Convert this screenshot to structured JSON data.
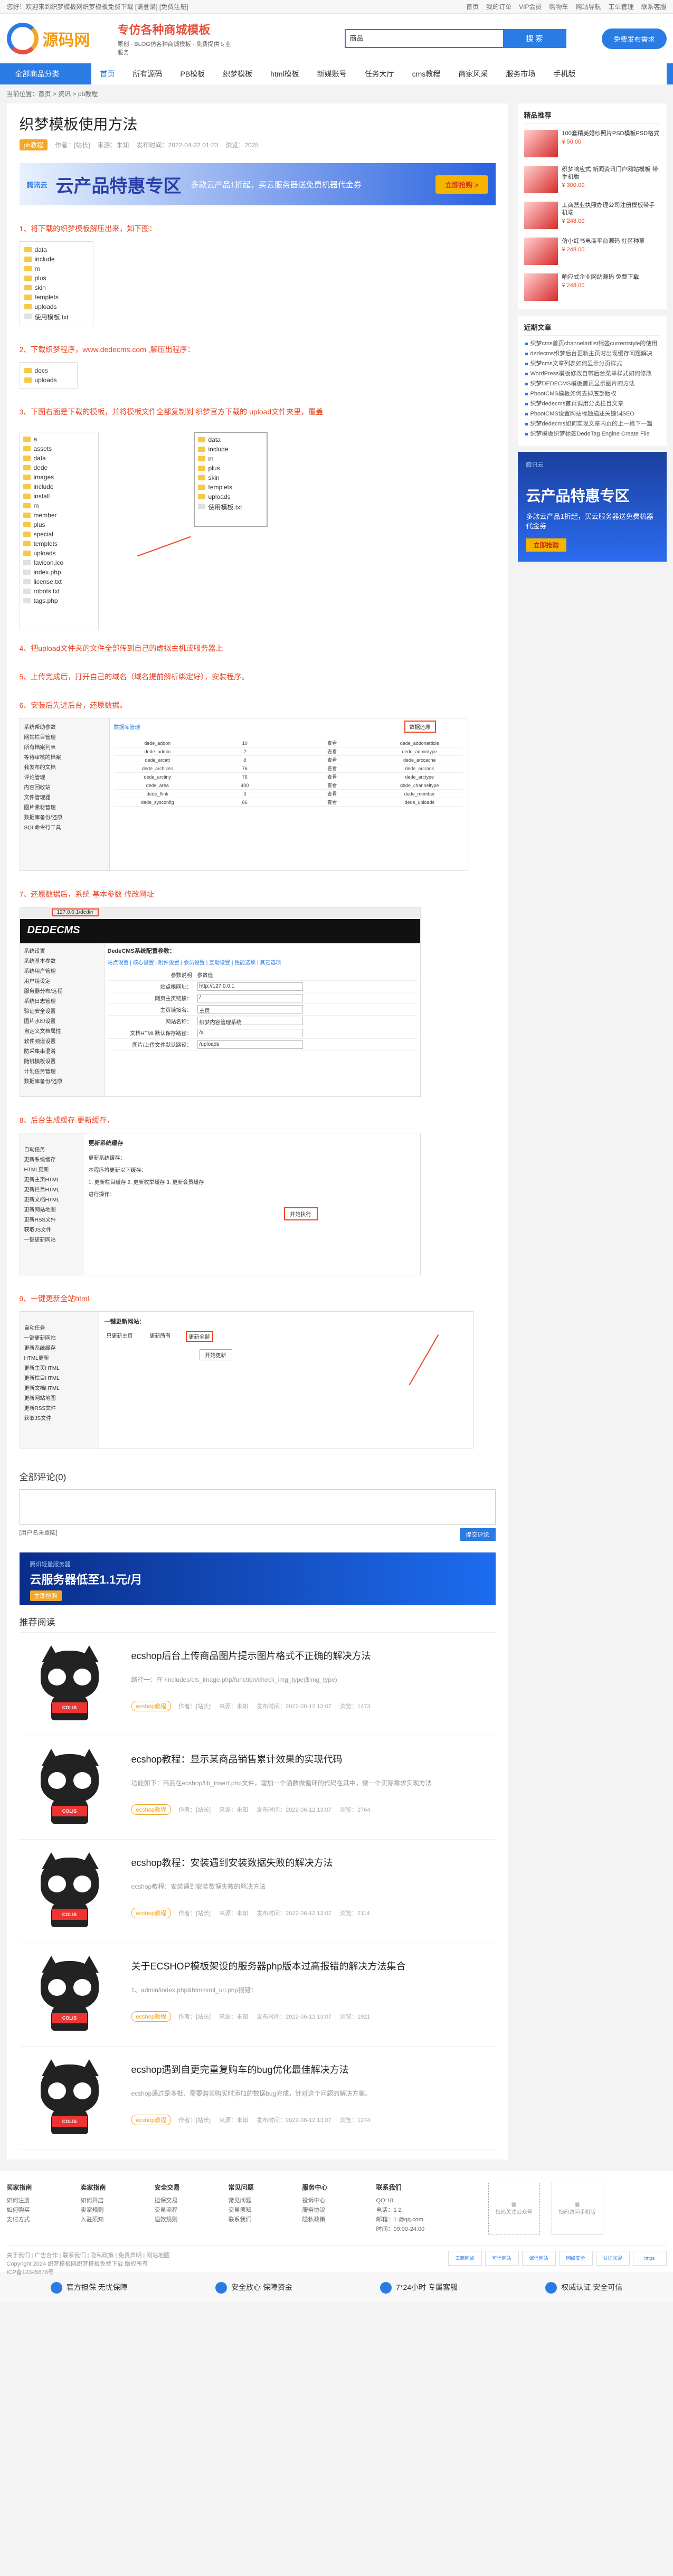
{
  "topbar": {
    "left": "您好！欢迎来到织梦模板网织梦模板免费下载 [请登录]",
    "left2": "[免费注册]",
    "links": [
      "首页",
      "我的订单",
      "VIP会员",
      "购物车",
      "网站导航",
      "工单管理",
      "联系客服"
    ]
  },
  "header": {
    "logo_text": "源码网",
    "slogan_1": "专仿各种商城模板",
    "slogan_2": "原创 · BLOG仿各种商城模板 · 免费提供专业服务",
    "search_select": "商品",
    "search_button": "搜 索",
    "search_hot": "织梦 dede 帝国 商城 主题 企业 模板",
    "cta": "免费发布需求"
  },
  "nav": {
    "category": "全部商品分类",
    "items": [
      "首页",
      "所有源码",
      "PB模板",
      "织梦模板",
      "html模板",
      "新媒账号",
      "任务大厅",
      "cms教程",
      "商家风采",
      "服务市场",
      "手机版"
    ]
  },
  "breadcrumb": "当前位置：首页 > 资讯 > pb教程",
  "article": {
    "title": "织梦模板使用方法",
    "tag": "pb教程",
    "author": "作者：[站长]",
    "source": "来源：未知",
    "time": "发布时间：2022-04-22 01:23",
    "views": "浏览：2025",
    "ad": {
      "brand": "腾讯云",
      "big": "云产品特惠专区",
      "sub": "多款云产品1折起，买云服务器送免费机器代金券",
      "cta": "立即抢购 >"
    },
    "steps": [
      "1、将下载的织梦模板解压出来，如下图：",
      "2、下载织梦程序，www.dedecms.com ,解压出程序：",
      "3、下图右面是下载的模板，并将模板文件全部复制到 织梦官方下载的 upload文件夹里，覆盖",
      "4、把upload文件夹的文件全部传到自己的虚拟主机或服务器上",
      "5、上传完成后，打开自己的域名（域名提前解析绑定好），安装程序。",
      "6、安装后先进后台，还原数据。",
      "7、还原数据后，系统-基本参数-修改网址",
      "8、后台生成缓存 更新缓存，",
      "9、一键更新全站html"
    ],
    "folders1": [
      "data",
      "include",
      "m",
      "plus",
      "skin",
      "templets",
      "uploads",
      "使用模板.txt"
    ],
    "folders2": [
      "docs",
      "uploads"
    ],
    "folders3a": [
      "a",
      "assets",
      "data",
      "dede",
      "images",
      "include",
      "install",
      "m",
      "member",
      "plus",
      "special",
      "templets",
      "uploads",
      "favicon.ico",
      "index.php",
      "license.txt",
      "robots.txt",
      "tags.php"
    ],
    "folders3b": [
      "data",
      "include",
      "m",
      "plus",
      "skin",
      "templets",
      "uploads",
      "使用模板.txt"
    ],
    "shot6": {
      "title": "数据库管理",
      "button": "数据还原",
      "menu": [
        "系统帮助参数",
        "网站栏目管理",
        "所有档案列表",
        "等待审核的档案",
        "我发布的文档",
        "评论管理",
        "内容回收站",
        "文件管理器",
        "图片素材管理",
        "数据库备份/还原",
        "SQL命令行工具"
      ],
      "rows": [
        [
          "dede_addon",
          "10",
          "查看",
          "dede_addonarticle"
        ],
        [
          "dede_admin",
          "2",
          "查看",
          "dede_admintype"
        ],
        [
          "dede_arcatt",
          "8",
          "查看",
          "dede_arccache"
        ],
        [
          "dede_archives",
          "76",
          "查看",
          "dede_arcrank"
        ],
        [
          "dede_arctiny",
          "76",
          "查看",
          "dede_arctype"
        ],
        [
          "dede_area",
          "400",
          "查看",
          "dede_channeltype"
        ],
        [
          "dede_flink",
          "3",
          "查看",
          "dede_member"
        ],
        [
          "dede_sysconfig",
          "86",
          "查看",
          "dede_uploads"
        ]
      ]
    },
    "shot7": {
      "url": "127.0.0.1/dede/",
      "logo": "DEDECMS",
      "title": "DedeCMS系统配置参数：",
      "tabs": "站点设置 | 核心设置 | 附件设置 | 会员设置 | 互动设置 | 性能选项 | 其它选项",
      "menu": [
        "系统设置",
        "系统基本参数",
        "系统用户管理",
        "用户组设定",
        "服务器分布/远程",
        "系统日志管理",
        "验证安全设置",
        "图片水印设置",
        "自定义文档属性",
        "软件频道设置",
        "防采集串混淆",
        "随机模板设置",
        "计划任务管理",
        "数据库备份/还原"
      ],
      "rows": [
        [
          "参数说明",
          "参数值"
        ],
        [
          "站点根网址：",
          "http://127.0.0.1"
        ],
        [
          "网页主页链接：",
          "/"
        ],
        [
          "主页链接名：",
          "主页"
        ],
        [
          "网站名称：",
          "织梦内容管理系统"
        ],
        [
          "文档HTML默认保存路径：",
          "/a"
        ],
        [
          "图片/上传文件默认路径：",
          "/uploads"
        ]
      ]
    },
    "shot8": {
      "title": "更新系统缓存",
      "lines": [
        "更新系统缓存：",
        "本程序将更新以下缓存：",
        "1. 更新栏目缓存 2. 更新枚举缓存 3. 更新会员缓存",
        "进行操作："
      ],
      "button": "开始执行",
      "menu": [
        "自动任务",
        "更新系统缓存",
        "HTML更新",
        "更新主页HTML",
        "更新栏目HTML",
        "更新文档HTML",
        "更新网站地图",
        "更新RSS文件",
        "获取JS文件",
        "一键更新网站"
      ]
    },
    "shot9": {
      "title": "一键更新网站：",
      "options": [
        "只更新主页",
        "更新所有",
        "更新全部"
      ],
      "button": "开始更新",
      "menu": [
        "自动任务",
        "一键更新网站",
        "更新系统缓存",
        "HTML更新",
        "更新主页HTML",
        "更新栏目HTML",
        "更新文档HTML",
        "更新网站地图",
        "更新RSS文件",
        "获取JS文件"
      ]
    }
  },
  "comments": {
    "title": "全部评论(0)",
    "login": "[用户名未登陆]",
    "submit": "提交评论"
  },
  "ad2": {
    "l1": "腾讯轻量服务器",
    "l2": "云服务器低至1.1元/月",
    "l3": "立即抢购"
  },
  "recommend": {
    "title": "推荐阅读",
    "items": [
      {
        "title": "ecshop后台上传商品图片提示图片格式不正确的解决方法",
        "excerpt": "路径一：在 /includes/cls_image.php/function/check_img_type($img_type)",
        "tag": "ecshop教程",
        "author": "作者：[站长]",
        "source": "来源：未知",
        "time": "发布时间：2022-06-12 13:07",
        "views": "浏览：1473"
      },
      {
        "title": "ecshop教程：显示某商品销售累计效果的实现代码",
        "excerpt": "功能如下：商品在ecshop/lib_insert.php文件，增加一个函数做循环的代码在其中，做一个实际需求实现方法",
        "tag": "ecshop教程",
        "author": "作者：[站长]",
        "source": "来源：未知",
        "time": "发布时间：2022-06-12 13:07",
        "views": "浏览：2764"
      },
      {
        "title": "ecshop教程：安装遇到安装数据失败的解决方法",
        "excerpt": "ecshop教程：安装遇到安装数据失败的解决方法",
        "tag": "ecshop教程",
        "author": "作者：[站长]",
        "source": "来源：未知",
        "time": "发布时间：2022-06-12 13:07",
        "views": "浏览：2114"
      },
      {
        "title": "关于ECSHOP模板架设的服务器php版本过高报错的解决方法集合",
        "excerpt": "1、admin/index.php&html/xml_url.php报错：",
        "tag": "ecshop教程",
        "author": "作者：[站长]",
        "source": "来源：未知",
        "time": "发布时间：2022-06-12 13:07",
        "views": "浏览：1921"
      },
      {
        "title": "ecshop遇到自更完重复购车的bug优化最佳解决方法",
        "excerpt": "ecshop通过是多批、需要购买购买时添加的数据bug完成，针对这个问题的解决方案。",
        "tag": "ecshop教程",
        "author": "作者：[站长]",
        "source": "来源：未知",
        "time": "发布时间：2022-06-12 13:07",
        "views": "浏览：1274"
      }
    ]
  },
  "sidebar": {
    "hot_title": "精品推荐",
    "hot": [
      {
        "text": "100套精美婚纱照片PSD模板PSD格式",
        "price": "¥ 50.00"
      },
      {
        "text": "织梦响应式 新闻资讯门户网站模板 带手机版",
        "price": "¥ 300.00"
      },
      {
        "text": "工商营业执照办理公司注册模板带手机端",
        "price": "¥ 248.00"
      },
      {
        "text": "仿小红书电商平台源码 社区种草",
        "price": "¥ 248.00"
      },
      {
        "text": "响应式企业网站源码 免费下载",
        "price": "¥ 248.00"
      }
    ],
    "latest_title": "近期文章",
    "latest": [
      "织梦cms首页channelartlist标签currentstyle的使用",
      "dedecms织梦后台更新主页时出现缓存问题解决",
      "织梦cms文章列表如何显示分页样式",
      "WordPress模板修改自带后台菜单样式如何修改",
      "织梦DEDECMS模板首页显示图片的方法",
      "PbootCMS模板如何去掉底部版权",
      "织梦dedecms首页调用分类栏目文章",
      "PbootCMS设置网站标题描述关键词SEO",
      "织梦dedecms如何实现文章内页的上一篇下一篇",
      "织梦模板织梦标签DedeTag Engine Create File"
    ],
    "ad": {
      "a1": "腾讯云",
      "a2": "云产品特惠专区",
      "a3": "多款云产品1折起，买云服务器送免费机器代金券",
      "a4": "立即抢购"
    }
  },
  "footer": {
    "cols": [
      {
        "title": "买家指南",
        "items": [
          "如何注册",
          "如何购买",
          "支付方式"
        ]
      },
      {
        "title": "卖家指南",
        "items": [
          "如何开店",
          "卖家规则",
          "入驻须知"
        ]
      },
      {
        "title": "安全交易",
        "items": [
          "担保交易",
          "交易流程",
          "退款规则"
        ]
      },
      {
        "title": "常见问题",
        "items": [
          "常见问题",
          "交易须知",
          "联系我们"
        ]
      },
      {
        "title": "服务中心",
        "items": [
          "投诉中心",
          "服务协议",
          "隐私政策"
        ]
      }
    ],
    "contact_title": "联系我们",
    "contact": [
      "QQ:10",
      "电话：1          2",
      "邮箱：1          @qq.com",
      "时间：09:00-24:00"
    ],
    "qr1": "扫码关注公众号",
    "qr2": "扫码访问手机版",
    "bottom_links": "关于我们 | 广告合作 | 联系我们 | 隐私政策 | 免责声明 | 网站地图",
    "copyright": "Copyright 2024 织梦模板网织梦模板免费下载 版权所有",
    "icp": "ICP备12345678号",
    "badges": [
      "工商网监",
      "可信网站",
      "诚信网站",
      "网络安全",
      "认证联盟",
      "https"
    ]
  },
  "guarantee": [
    "官方担保 无忧保障",
    "安全放心 保障资金",
    "7*24小时 专属客服",
    "权威认证 安全可信"
  ]
}
